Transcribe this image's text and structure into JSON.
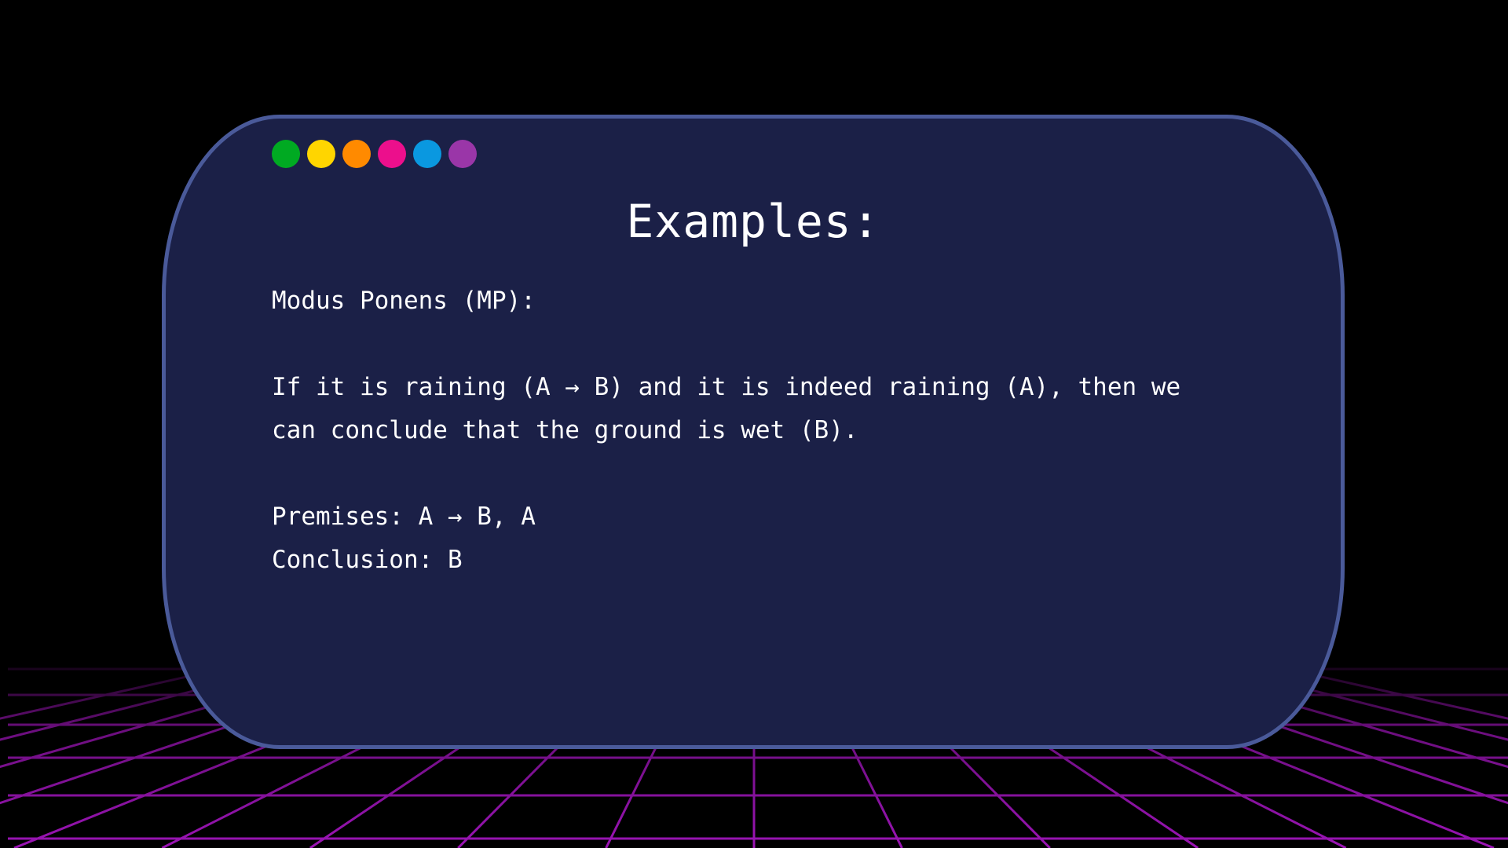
{
  "colors": {
    "background": "#000000",
    "card_fill": "#1b2047",
    "card_border": "#4a5a9a",
    "grid_line": "#9a14b4",
    "text": "#ffffff"
  },
  "window_dots": [
    {
      "name": "green-dot",
      "color": "#00aa22"
    },
    {
      "name": "yellow-dot",
      "color": "#ffd500"
    },
    {
      "name": "orange-dot",
      "color": "#ff8a00"
    },
    {
      "name": "pink-dot",
      "color": "#ec0f8c"
    },
    {
      "name": "blue-dot",
      "color": "#0a98e0"
    },
    {
      "name": "purple-dot",
      "color": "#9a36a8"
    }
  ],
  "slide": {
    "title": "Examples:",
    "heading": "Modus Ponens (MP):",
    "example_line_1": "If it is raining (A → B) and it is indeed raining (A), then we",
    "example_line_2": "can conclude that the ground is wet (B).",
    "premises": "Premises: A → B, A",
    "conclusion": "Conclusion: B"
  }
}
